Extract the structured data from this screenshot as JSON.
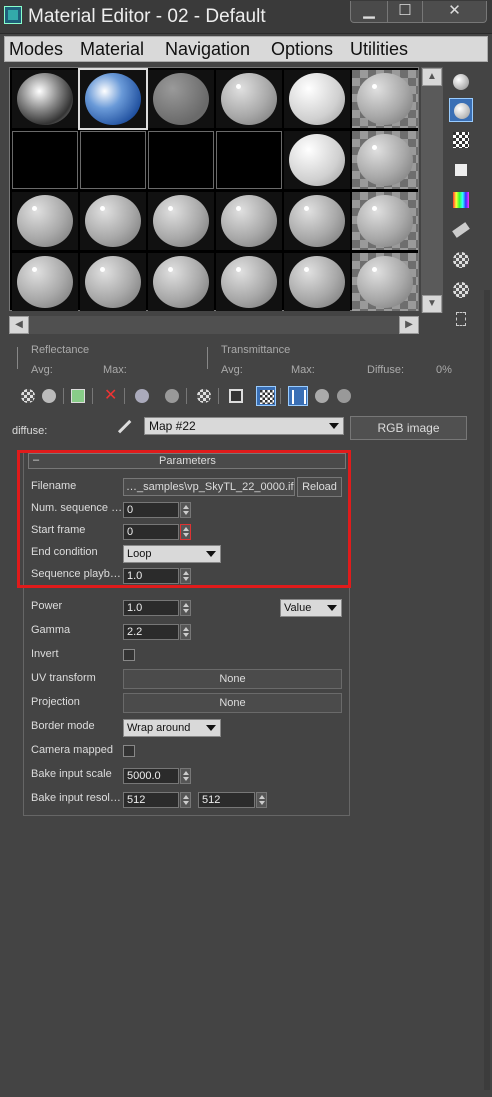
{
  "window": {
    "title": "Material Editor - 02 - Default",
    "minimize": "▁",
    "maximize": "☐",
    "close": "✕"
  },
  "menu": [
    "Modes",
    "Material",
    "Navigation",
    "Options",
    "Utilities"
  ],
  "info": {
    "reflectance": "Reflectance",
    "refl_avg": "Avg:",
    "refl_max": "Max:",
    "transmittance": "Transmittance",
    "trans_avg": "Avg:",
    "trans_max": "Max:",
    "diffuse": "Diffuse:",
    "diffuse_value": "0%"
  },
  "map_row": {
    "label": "diffuse:",
    "map_name": "Map #22",
    "map_type": "RGB image"
  },
  "parameters": {
    "title": "Parameters",
    "collapse": "–",
    "filename_label": "Filename",
    "filename_value": "…_samples\\vp_SkyTL_22_0000.ifl",
    "reload": "Reload",
    "num_sequence_label": "Num. sequence …",
    "num_sequence_value": "0",
    "start_frame_label": "Start frame",
    "start_frame_value": "0",
    "end_condition_label": "End condition",
    "end_condition_value": "Loop",
    "sequence_playback_label": "Sequence playb…",
    "sequence_playback_value": "1.0",
    "power_label": "Power",
    "power_value": "1.0",
    "power_mode": "Value",
    "gamma_label": "Gamma",
    "gamma_value": "2.2",
    "invert_label": "Invert",
    "uv_transform_label": "UV transform",
    "uv_transform_value": "None",
    "projection_label": "Projection",
    "projection_value": "None",
    "border_mode_label": "Border mode",
    "border_mode_value": "Wrap around",
    "camera_mapped_label": "Camera mapped",
    "bake_scale_label": "Bake input scale",
    "bake_scale_value": "5000.0",
    "bake_res_label": "Bake input resol…",
    "bake_res_x": "512",
    "bake_res_y": "512"
  },
  "icons": {
    "sample_type": "sphere-icon",
    "backlight": "backlight-icon",
    "background": "checker-background-icon",
    "uv_tiling": "tiling-icon",
    "video_color": "video-color-check-icon",
    "make_preview": "make-preview-icon",
    "options": "options-icon",
    "select_by_material": "select-by-material-icon",
    "material_navigator": "navigator-icon"
  }
}
